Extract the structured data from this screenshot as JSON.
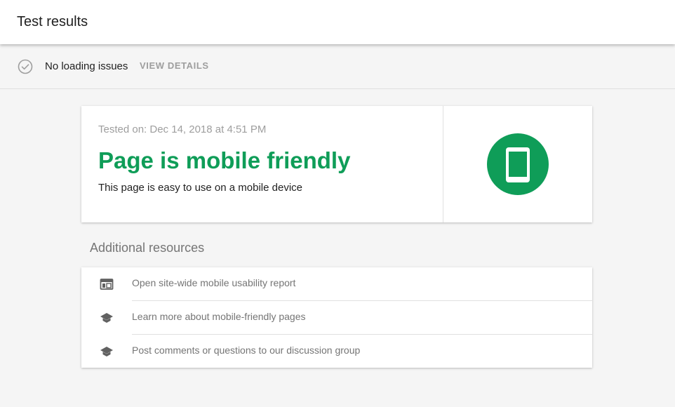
{
  "header": {
    "title": "Test results"
  },
  "status": {
    "icon": "check-circle-icon",
    "text": "No loading issues",
    "action_label": "VIEW DETAILS"
  },
  "result": {
    "tested_on": "Tested on: Dec 14, 2018 at 4:51 PM",
    "title": "Page is mobile friendly",
    "subtitle": "This page is easy to use on a mobile device",
    "badge_icon": "smartphone-icon",
    "accent_color": "#0f9d58"
  },
  "resources": {
    "heading": "Additional resources",
    "items": [
      {
        "icon": "web-report-icon",
        "label": "Open site-wide mobile usability report"
      },
      {
        "icon": "school-cap-icon",
        "label": "Learn more about mobile-friendly pages"
      },
      {
        "icon": "school-cap-icon",
        "label": "Post comments or questions to our discussion group"
      }
    ]
  }
}
